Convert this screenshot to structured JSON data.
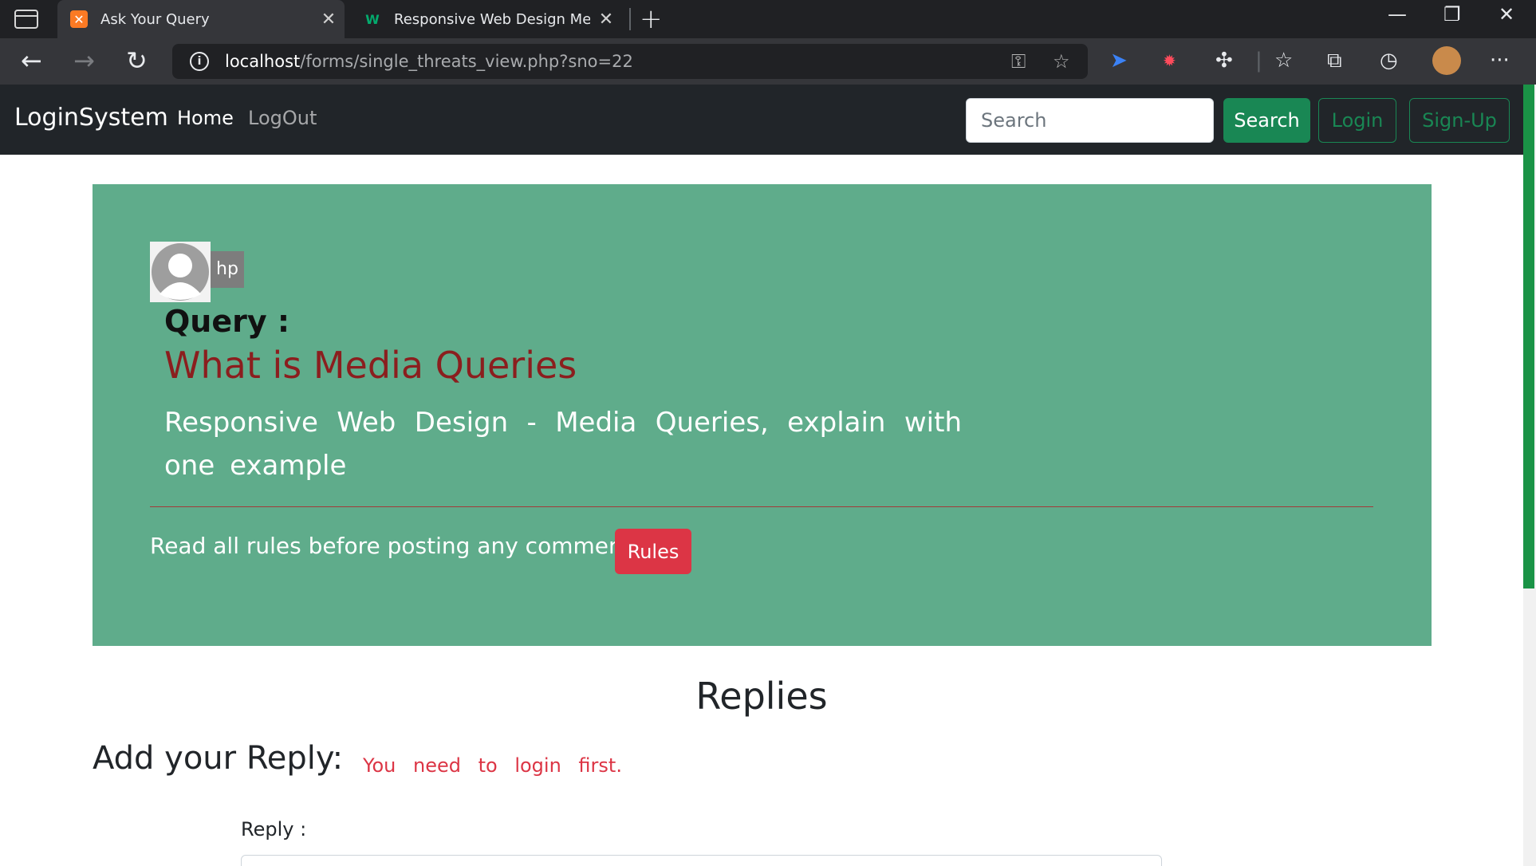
{
  "browser": {
    "tabs": [
      {
        "title": "Ask Your Query",
        "favicon": "xampp-icon",
        "active": true
      },
      {
        "title": "Responsive Web Design Media Q",
        "favicon": "w3schools-icon",
        "active": false
      }
    ],
    "url_host": "localhost",
    "url_path": "/forms/single_threats_view.php?sno=22"
  },
  "navbar": {
    "brand": "LoginSystem",
    "links": [
      "Home",
      "LogOut"
    ],
    "search_placeholder": "Search",
    "search_button": "Search",
    "login_button": "Login",
    "signup_button": "Sign-Up"
  },
  "thread": {
    "username": "hp",
    "query_label": "Query :",
    "title": "What is Media Queries",
    "description": "Responsive Web Design - Media Queries, explain with one example",
    "rules_text": "Read all rules before posting any comment.",
    "rules_button": "Rules"
  },
  "replies": {
    "heading": "Replies",
    "add_reply": "Add your Reply:",
    "login_note": "You need to login first.",
    "reply_label": "Reply :"
  },
  "colors": {
    "jumbotron": "#5fac8b",
    "navbar": "#212529",
    "success": "#198754",
    "danger": "#dc3545",
    "query_title": "#8b1e1e"
  }
}
